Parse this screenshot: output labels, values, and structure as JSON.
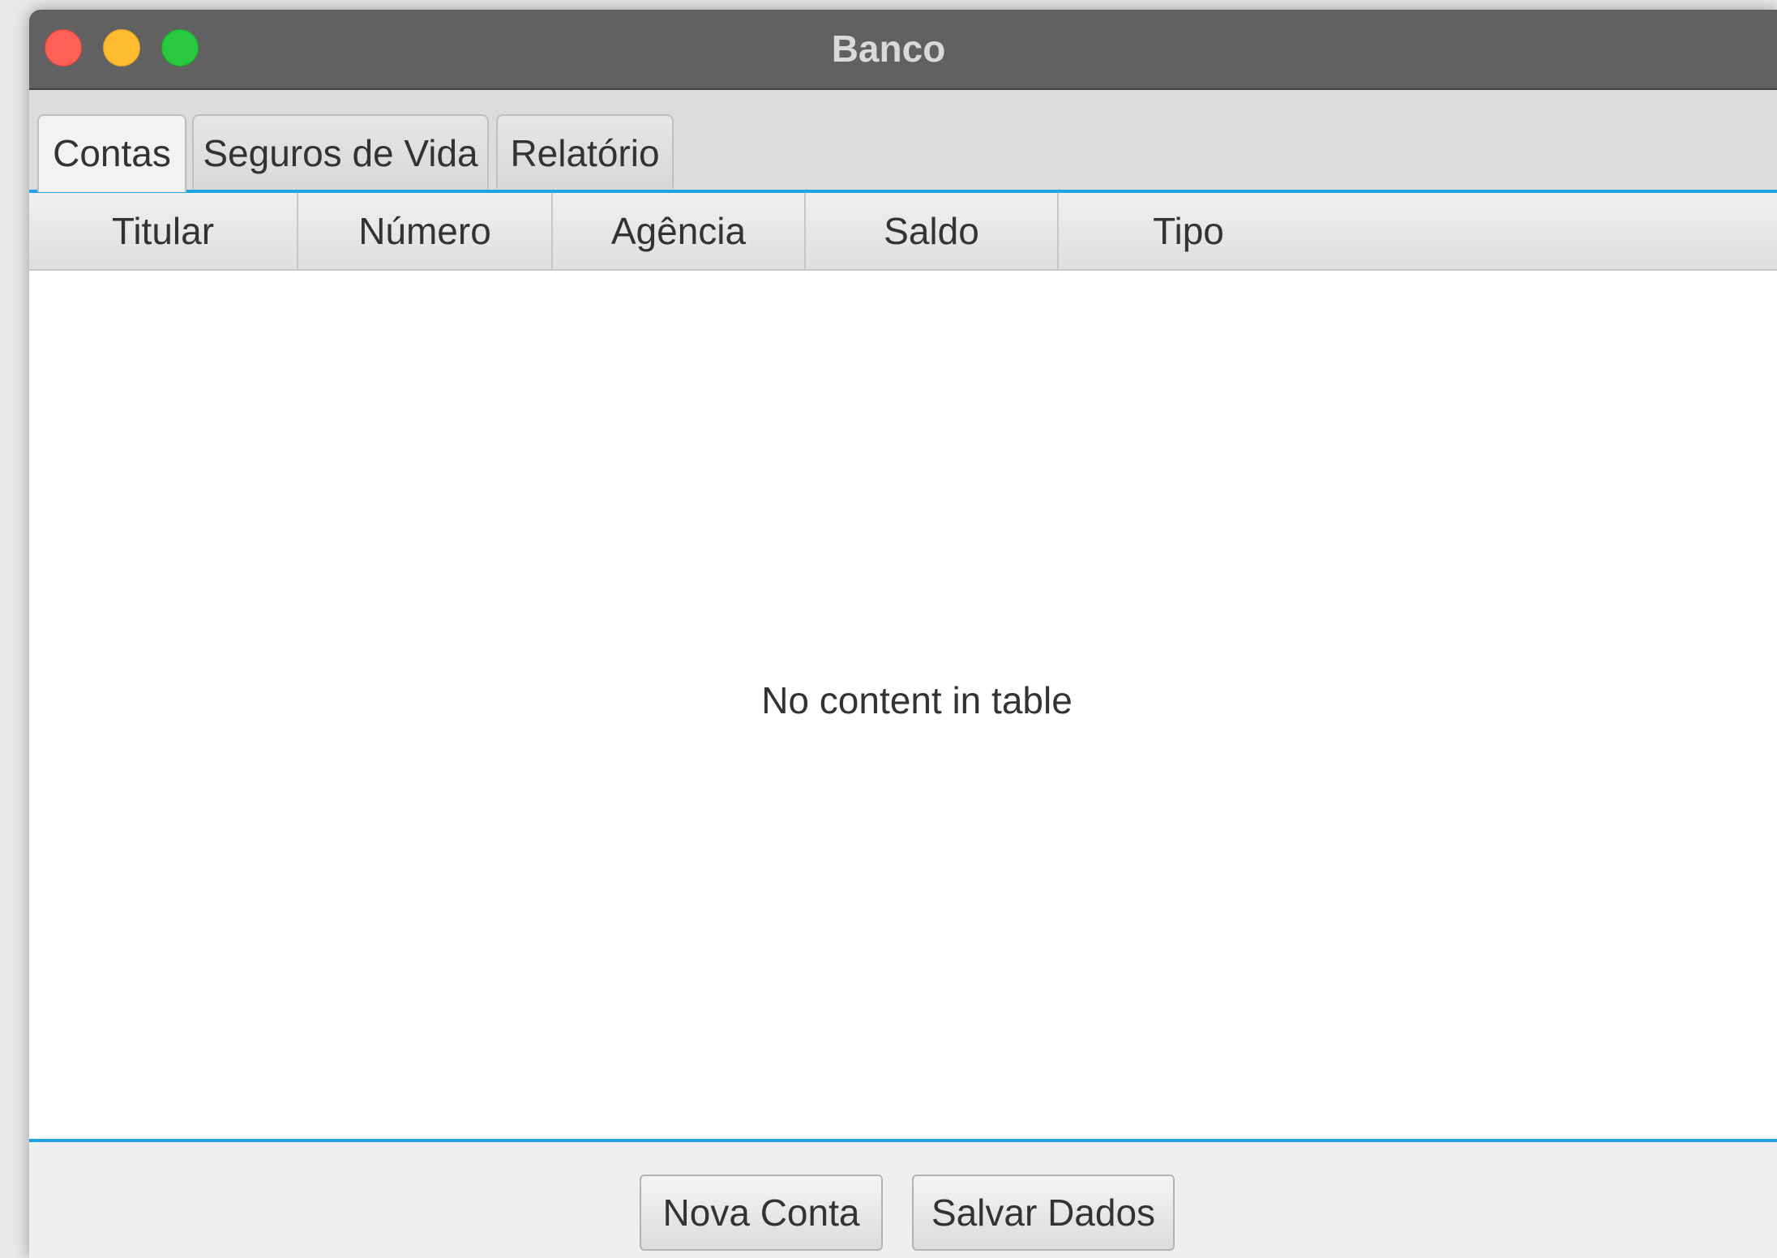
{
  "window": {
    "title": "Banco"
  },
  "tabs": [
    {
      "label": "Contas",
      "selected": true
    },
    {
      "label": "Seguros de Vida",
      "selected": false
    },
    {
      "label": "Relatório",
      "selected": false
    }
  ],
  "table": {
    "columns": [
      "Titular",
      "Número",
      "Agência",
      "Saldo",
      "Tipo"
    ],
    "rows": [],
    "placeholder": "No content in table"
  },
  "actions": {
    "new_account": "Nova Conta",
    "save_data": "Salvar Dados"
  },
  "colors": {
    "accent": "#1ea3e0",
    "titlebar": "#616161",
    "close": "#fe5f57",
    "minimize": "#febc2e",
    "maximize": "#28c840"
  }
}
